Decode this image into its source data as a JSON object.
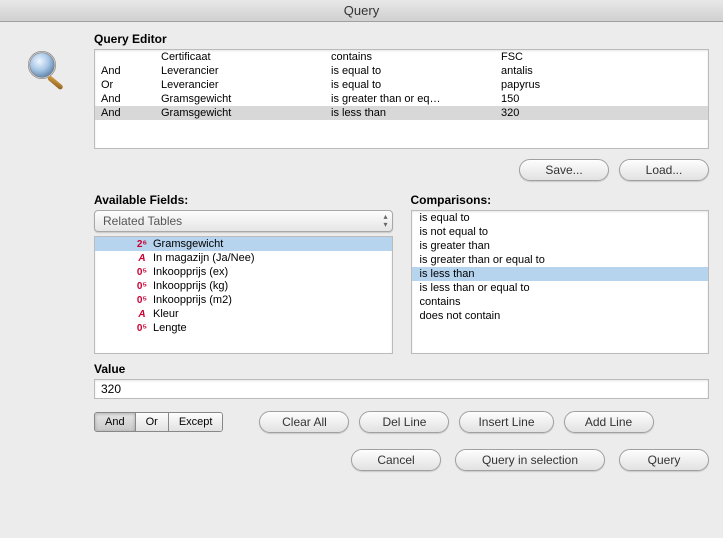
{
  "window": {
    "title": "Query"
  },
  "editor": {
    "label": "Query Editor",
    "rows": [
      {
        "conj": "",
        "field": "Certificaat",
        "comp": "contains",
        "value": "FSC",
        "selected": false
      },
      {
        "conj": "And",
        "field": "Leverancier",
        "comp": "is equal to",
        "value": "antalis",
        "selected": false
      },
      {
        "conj": "Or",
        "field": "Leverancier",
        "comp": "is equal to",
        "value": "papyrus",
        "selected": false
      },
      {
        "conj": "And",
        "field": "Gramsgewicht",
        "comp": "is greater than or eq…",
        "value": "150",
        "selected": false
      },
      {
        "conj": "And",
        "field": "Gramsgewicht",
        "comp": "is less than",
        "value": "320",
        "selected": true
      }
    ]
  },
  "buttons": {
    "save": "Save...",
    "load": "Load...",
    "clear_all": "Clear All",
    "del_line": "Del Line",
    "insert_line": "Insert Line",
    "add_line": "Add Line",
    "cancel": "Cancel",
    "query_in_selection": "Query in selection",
    "query": "Query"
  },
  "fields": {
    "label": "Available Fields:",
    "popup": "Related Tables",
    "items": [
      {
        "icon": "26",
        "label": "Gramsgewicht",
        "selected": true
      },
      {
        "icon": "a",
        "label": "In magazijn (Ja/Nee)",
        "selected": false
      },
      {
        "icon": "05",
        "label": "Inkoopprijs (ex)",
        "selected": false
      },
      {
        "icon": "05",
        "label": "Inkoopprijs (kg)",
        "selected": false
      },
      {
        "icon": "05",
        "label": "Inkoopprijs (m2)",
        "selected": false
      },
      {
        "icon": "a",
        "label": "Kleur",
        "selected": false
      },
      {
        "icon": "05",
        "label": "Lengte",
        "selected": false
      }
    ]
  },
  "comparisons": {
    "label": "Comparisons:",
    "items": [
      {
        "label": "is equal to",
        "selected": false
      },
      {
        "label": "is not equal to",
        "selected": false
      },
      {
        "label": "is greater than",
        "selected": false
      },
      {
        "label": "is greater than or equal to",
        "selected": false
      },
      {
        "label": "is less than",
        "selected": true
      },
      {
        "label": "is less than or equal to",
        "selected": false
      },
      {
        "label": "contains",
        "selected": false
      },
      {
        "label": "does not contain",
        "selected": false
      }
    ]
  },
  "value": {
    "label": "Value",
    "text": "320"
  },
  "conjunction": {
    "and": "And",
    "or": "Or",
    "except": "Except",
    "active": "and"
  }
}
